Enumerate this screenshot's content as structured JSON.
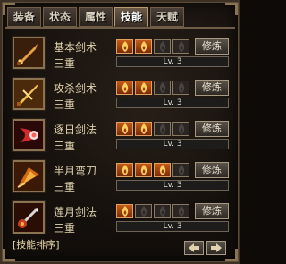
{
  "tabs": [
    {
      "label": "装备",
      "active": false
    },
    {
      "label": "状态",
      "active": false
    },
    {
      "label": "属性",
      "active": false
    },
    {
      "label": "技能",
      "active": true
    },
    {
      "label": "天赋",
      "active": false
    }
  ],
  "skills": [
    {
      "name": "基本剑术",
      "level": "三重",
      "stars_filled": 2,
      "stars_total": 4,
      "lv_text": "Lv. 3",
      "train_label": "修炼",
      "icon": "sword-icon",
      "progress": 0.0
    },
    {
      "name": "攻杀剑术",
      "level": "三重",
      "stars_filled": 2,
      "stars_total": 4,
      "lv_text": "Lv. 3",
      "train_label": "修炼",
      "icon": "golden-sword-icon",
      "progress": 0.0
    },
    {
      "name": "逐日剑法",
      "level": "三重",
      "stars_filled": 2,
      "stars_total": 4,
      "lv_text": "Lv. 3",
      "train_label": "修炼",
      "icon": "crescent-slash-icon",
      "progress": 0.0
    },
    {
      "name": "半月弯刀",
      "level": "三重",
      "stars_filled": 3,
      "stars_total": 4,
      "lv_text": "Lv. 3",
      "train_label": "修炼",
      "icon": "blade-fan-icon",
      "progress": 0.0
    },
    {
      "name": "莲月剑法",
      "level": "三重",
      "stars_filled": 1,
      "stars_total": 4,
      "lv_text": "Lv. 3",
      "train_label": "修炼",
      "icon": "lotus-sword-icon",
      "progress": 0.0
    }
  ],
  "footer": {
    "sort_label": "[技能排序]"
  },
  "colors": {
    "accent": "#8a7350",
    "slot_on": "#c45a18",
    "text": "#e0d2b0"
  }
}
